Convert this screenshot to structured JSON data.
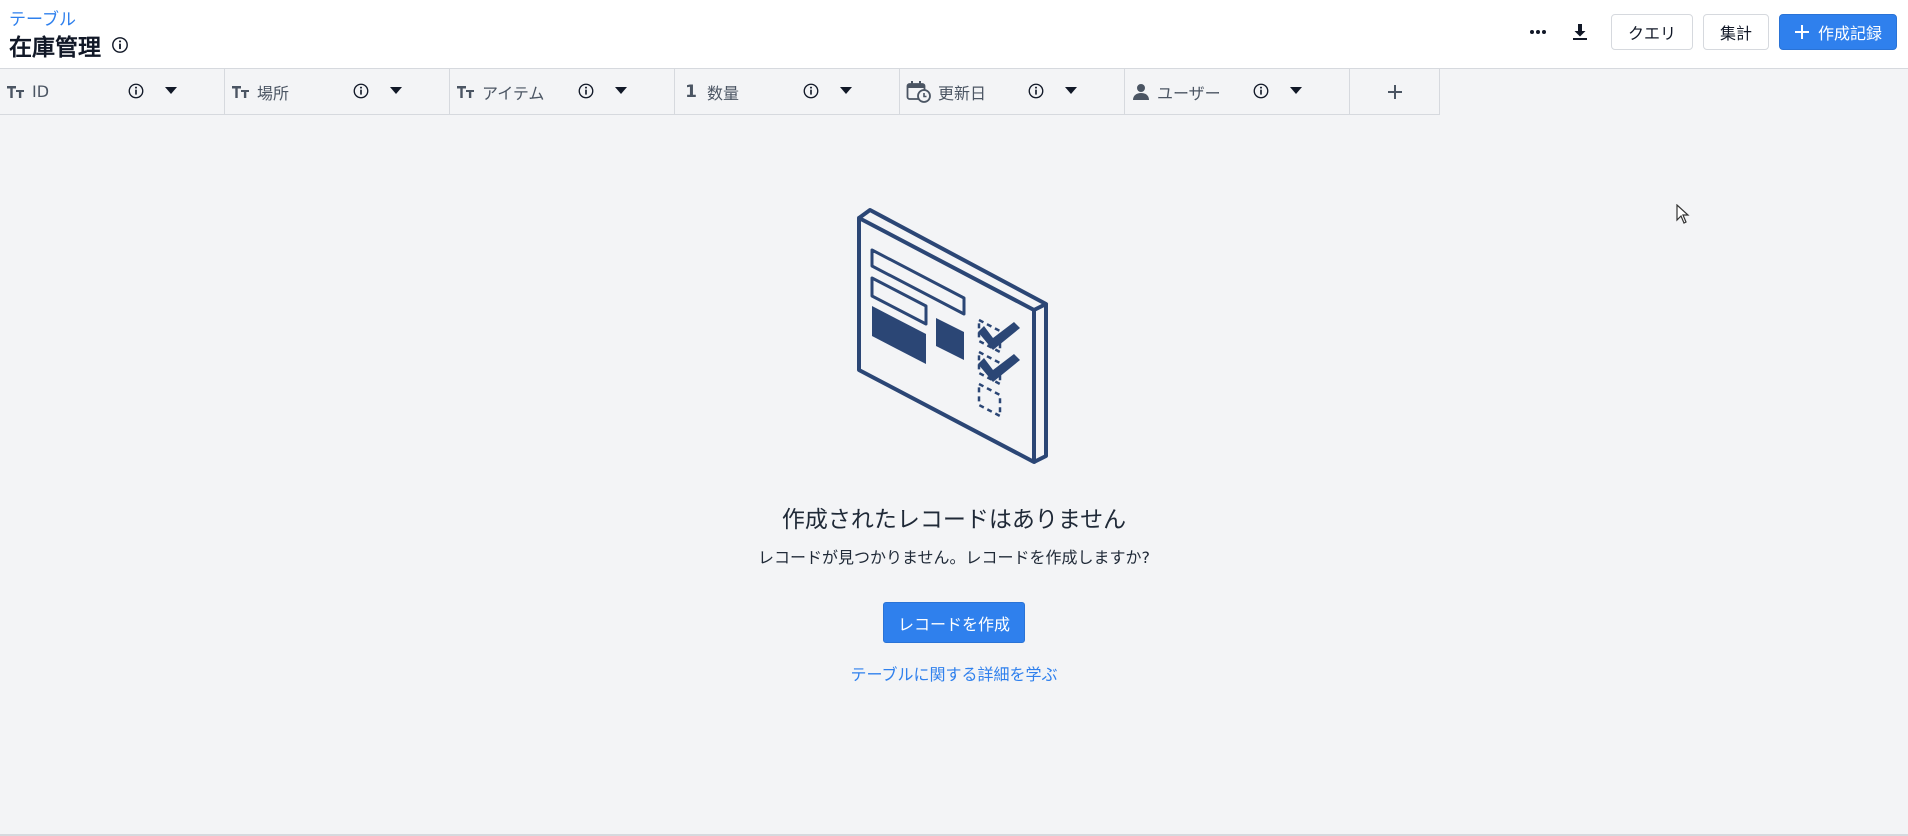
{
  "header": {
    "breadcrumb": "テーブル",
    "title": "在庫管理",
    "query_label": "クエリ",
    "aggregate_label": "集計",
    "create_record_label": "作成記録"
  },
  "columns": [
    {
      "label": "ID",
      "type_icon": "text-type-icon"
    },
    {
      "label": "場所",
      "type_icon": "text-type-icon"
    },
    {
      "label": "アイテム",
      "type_icon": "text-type-icon"
    },
    {
      "label": "数量",
      "type_icon": "number-type-icon",
      "type_glyph": "1"
    },
    {
      "label": "更新日",
      "type_icon": "calendar-clock-icon"
    },
    {
      "label": "ユーザー",
      "type_icon": "user-icon"
    }
  ],
  "empty_state": {
    "title": "作成されたレコードはありません",
    "subtitle": "レコードが見つかりません。レコードを作成しますか?",
    "create_button": "レコードを作成",
    "learn_link": "テーブルに関する詳細を学ぶ"
  },
  "colors": {
    "accent": "#2f80ed",
    "illustration": "#2b4675",
    "background": "#f3f4f6"
  }
}
